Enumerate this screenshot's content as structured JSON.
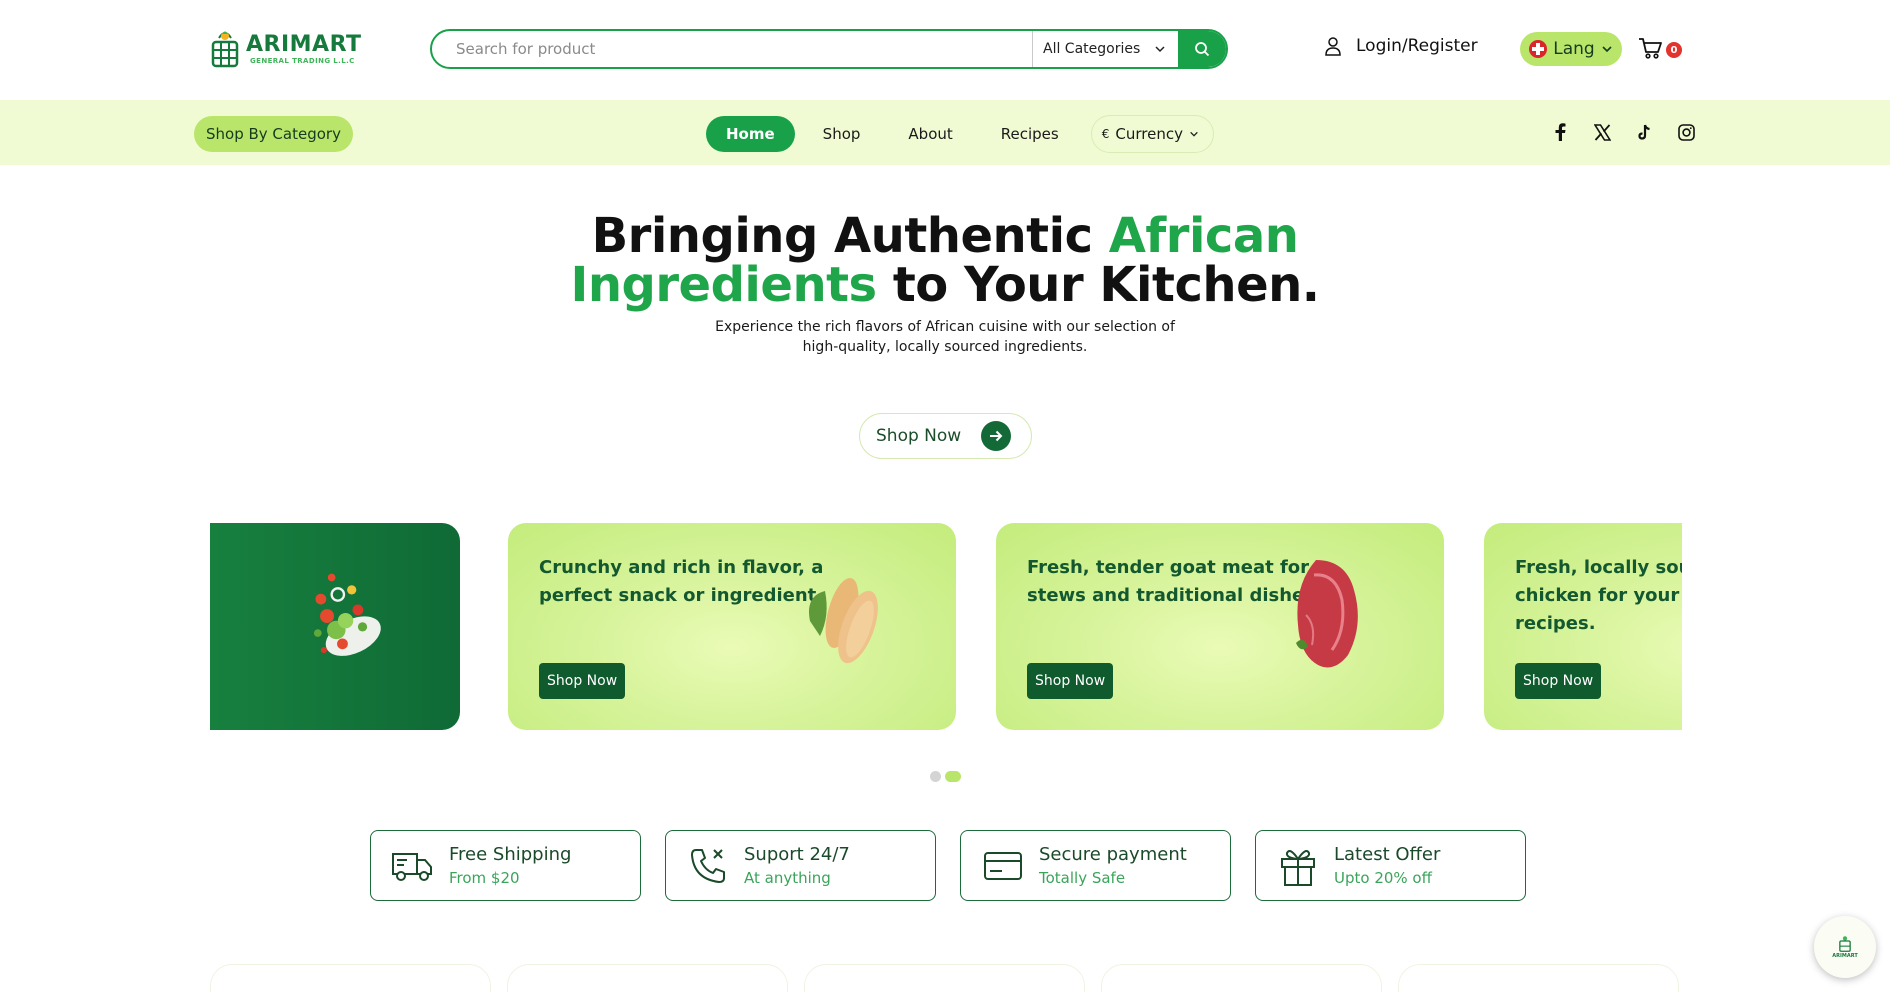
{
  "header": {
    "logo_name": "ARIMART",
    "logo_sub": "GENERAL TRADING L.L.C",
    "search_placeholder": "Search for product",
    "category_select": "All Categories",
    "login_label": "Login/Register",
    "lang_label": "Lang",
    "cart_count": "0"
  },
  "nav": {
    "shop_by_category": "Shop By Category",
    "items": [
      {
        "label": "Home",
        "active": true
      },
      {
        "label": "Shop",
        "active": false
      },
      {
        "label": "About",
        "active": false
      },
      {
        "label": "Recipes",
        "active": false
      }
    ],
    "currency_symbol": "€",
    "currency_label": "Currency",
    "socials": [
      "facebook-icon",
      "x-icon",
      "tiktok-icon",
      "instagram-icon"
    ]
  },
  "hero": {
    "title_part1": "Bringing Authentic ",
    "title_green1": "African",
    "title_green2": "Ingredients",
    "title_part2": " to Your Kitchen.",
    "subtitle_line1": "Experience the rich flavors of African cuisine with our selection of",
    "subtitle_line2": "high-quality, locally sourced ingredients.",
    "cta": "Shop Now"
  },
  "carousel": {
    "cards": [
      {
        "text": "",
        "button": ""
      },
      {
        "text_line1": "Crunchy and rich in flavor, a",
        "text_line2": "perfect snack or ingredient",
        "button": "Shop Now"
      },
      {
        "text_line1": "Fresh, tender goat meat for",
        "text_line2": "stews and traditional dishes",
        "button": "Shop Now"
      },
      {
        "text_line1": "Fresh, locally sourced",
        "text_line2": "chicken for your traditional",
        "text_line3": "recipes.",
        "button": "Shop Now"
      }
    ],
    "active_dot": 1
  },
  "features": [
    {
      "icon": "truck-icon",
      "title": "Free Shipping",
      "sub": "From $20"
    },
    {
      "icon": "phone-icon",
      "title": "Suport 24/7",
      "sub": "At anything"
    },
    {
      "icon": "card-icon",
      "title": "Secure payment",
      "sub": "Totally Safe"
    },
    {
      "icon": "gift-icon",
      "title": "Latest Offer",
      "sub": "Upto 20% off"
    }
  ],
  "colors": {
    "primary_green": "#19a14a",
    "dark_green": "#0f5b2e",
    "lime": "#b9e56a",
    "nav_band": "#f0fbd3",
    "badge_red": "#e3332f"
  }
}
